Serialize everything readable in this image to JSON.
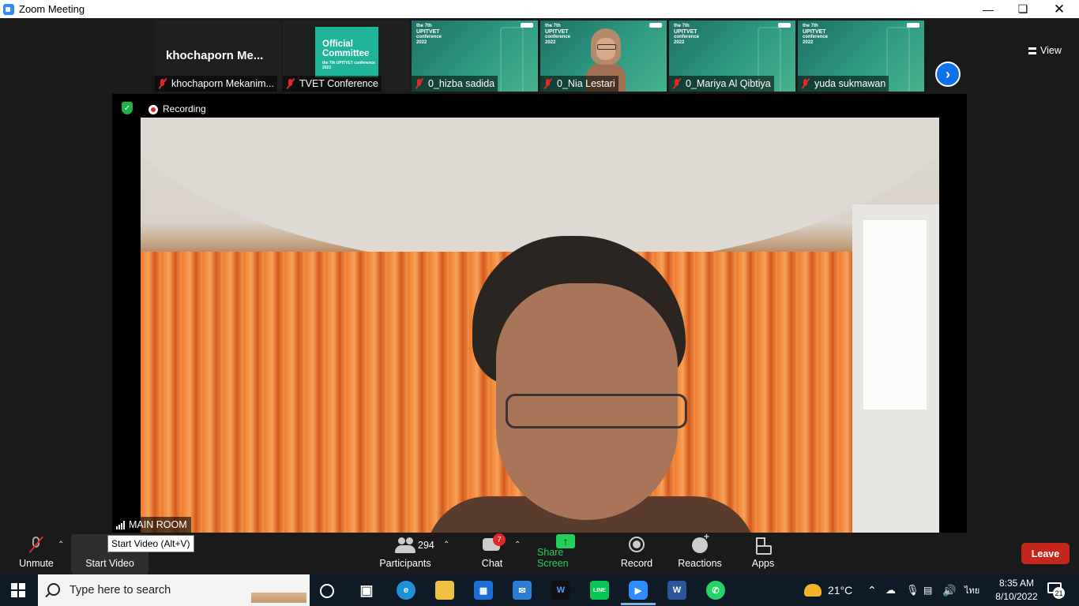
{
  "window": {
    "title": "Zoom Meeting"
  },
  "gallery": {
    "view_label": "View",
    "tiles": [
      {
        "display": "khochaporn  Me...",
        "name": "khochaporn Mekanim..."
      },
      {
        "name": "TVET Conference",
        "overlay_title": "Official Committee",
        "overlay_sub": "the 7th UPITVET conference 2022"
      },
      {
        "name": "0_hizba sadida"
      },
      {
        "name": "0_Nia Lestari"
      },
      {
        "name": "0_Mariya Al Qibtiya"
      },
      {
        "name": "yuda sukmawan"
      }
    ],
    "brand_lines": [
      "the 7th",
      "UPITVET",
      "conference",
      "2022"
    ]
  },
  "main": {
    "recording_label": "Recording",
    "room_label": "MAIN ROOM"
  },
  "toolbar": {
    "unmute": "Unmute",
    "start_video": "Start Video",
    "tooltip": "Start Video (Alt+V)",
    "participants": "Participants",
    "participants_count": "294",
    "chat": "Chat",
    "chat_badge": "7",
    "share_screen": "Share Screen",
    "record": "Record",
    "reactions": "Reactions",
    "apps": "Apps",
    "leave": "Leave"
  },
  "taskbar": {
    "search_placeholder": "Type here to search",
    "weather": "21°C",
    "language": "ไทย",
    "time": "8:35 AM",
    "date": "8/10/2022",
    "notifications": "21"
  },
  "colors": {
    "accent": "#0e72ed",
    "leave": "#c4261d",
    "share": "#23d05c",
    "mute": "#e02828"
  }
}
